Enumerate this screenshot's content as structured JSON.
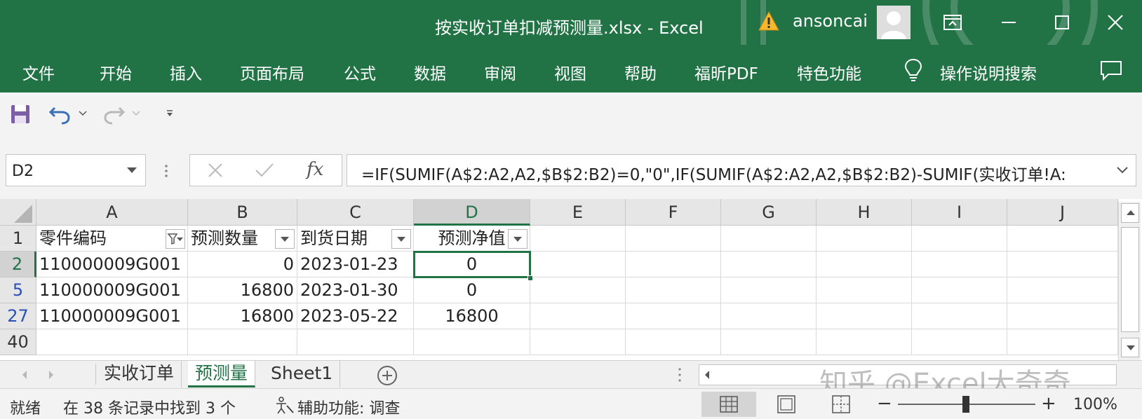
{
  "window": {
    "title": "按实收订单扣减预测量.xlsx  -  Excel",
    "user": "ansoncai",
    "accent": "#217346"
  },
  "ribbon": {
    "tabs": [
      "文件",
      "开始",
      "插入",
      "页面布局",
      "公式",
      "数据",
      "审阅",
      "视图",
      "帮助",
      "福昕PDF",
      "特色功能"
    ],
    "tell_me": "操作说明搜索"
  },
  "formula_bar": {
    "name_box": "D2",
    "fx": "fx",
    "formula": "=IF(SUMIF(A$2:A2,A2,$B$2:B2)=0,\"0\",IF(SUMIF(A$2:A2,A2,$B$2:B2)-SUMIF(实收订单!A:"
  },
  "grid": {
    "columns": [
      "A",
      "B",
      "C",
      "D",
      "E",
      "F",
      "G",
      "H",
      "I",
      "J"
    ],
    "header_row": {
      "row_num": "1",
      "cells": [
        "零件编码",
        "预测数量",
        "到货日期",
        "预测净值"
      ]
    },
    "rows": [
      {
        "row_num": "2",
        "cells": [
          "110000009G001",
          "0",
          "2023-01-23",
          "0"
        ]
      },
      {
        "row_num": "5",
        "cells": [
          "110000009G001",
          "16800",
          "2023-01-30",
          "0"
        ]
      },
      {
        "row_num": "27",
        "cells": [
          "110000009G001",
          "16800",
          "2023-05-22",
          "16800"
        ]
      },
      {
        "row_num": "40",
        "cells": [
          "",
          "",
          "",
          ""
        ]
      }
    ],
    "selected_cell": "D2"
  },
  "sheets": {
    "tabs": [
      "实收订单",
      "预测量",
      "Sheet1"
    ],
    "active": "预测量"
  },
  "watermark": "知乎 @Excel大奇奇",
  "status": {
    "ready": "就绪",
    "filter_info": "在 38 条记录中找到 3 个",
    "accessibility": "辅助功能: 调查",
    "zoom": "100%"
  }
}
